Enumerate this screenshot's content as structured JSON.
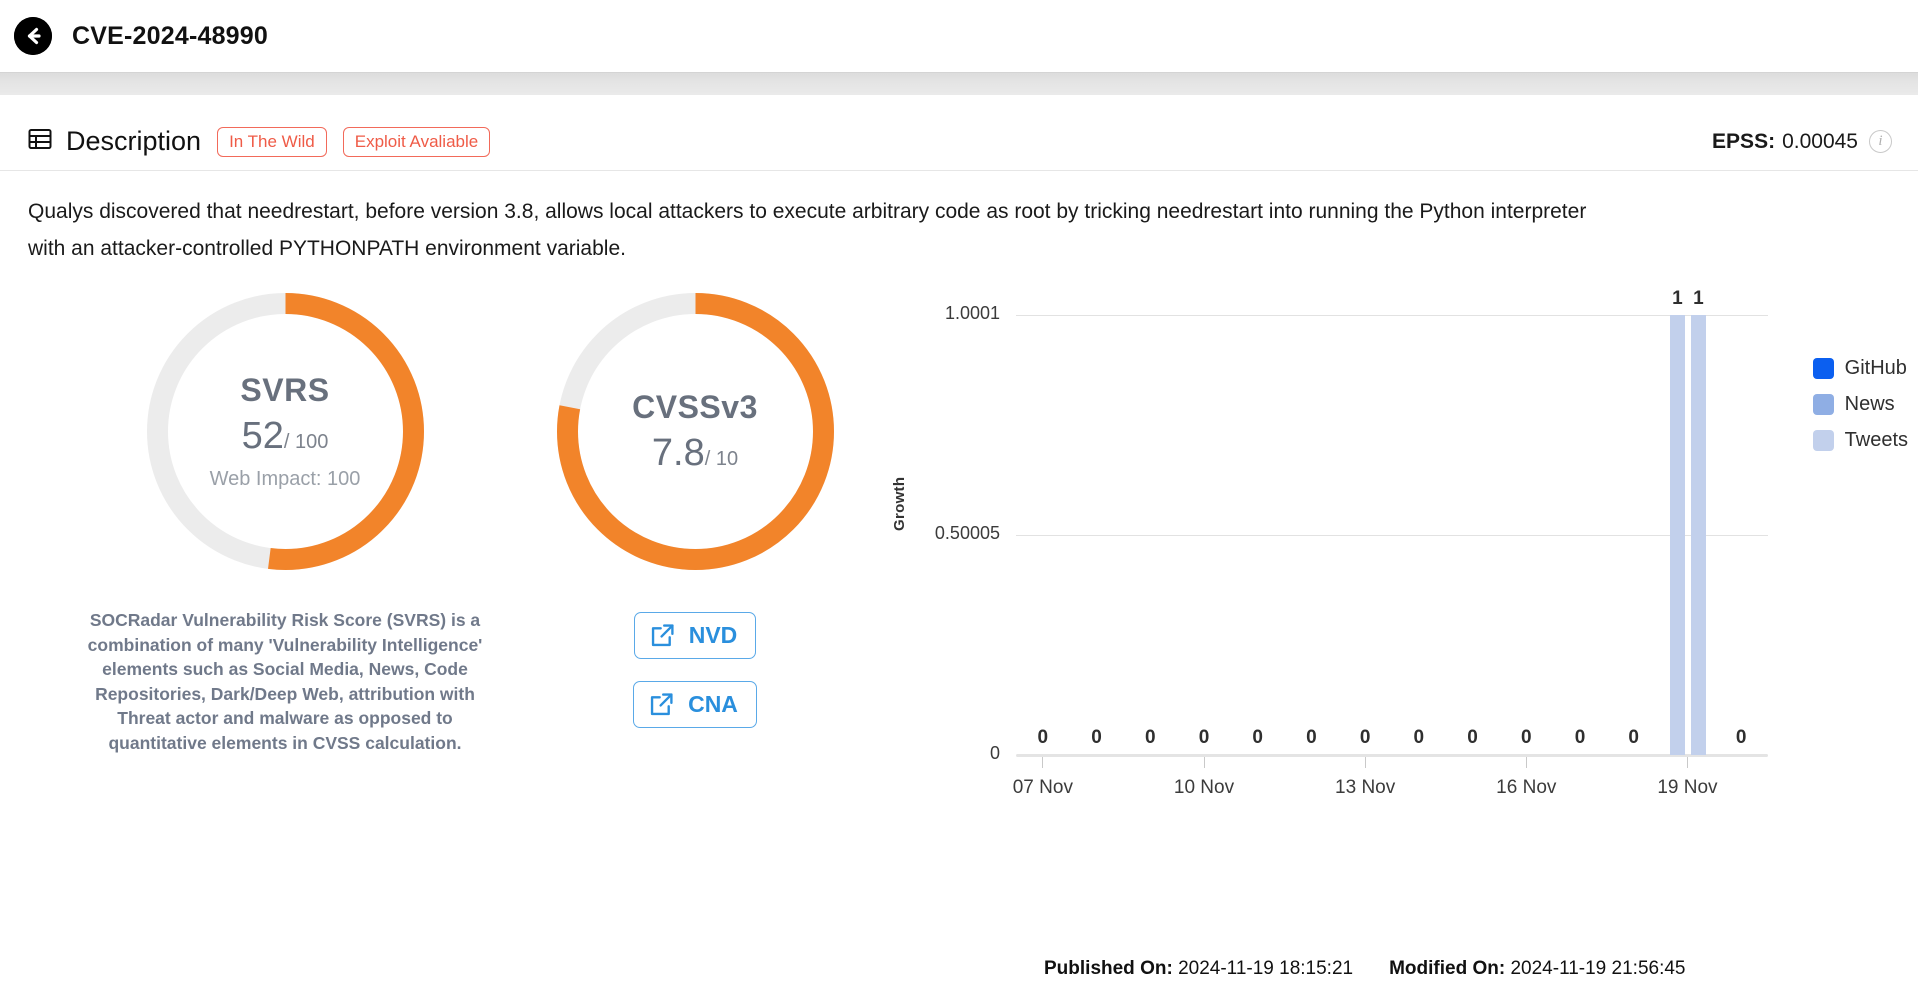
{
  "header": {
    "back_icon": "arrow-left-circle-icon",
    "cve_id": "CVE-2024-48990"
  },
  "description_section": {
    "section_icon": "table-list-icon",
    "title": "Description",
    "tags": [
      "In The Wild",
      "Exploit Avaliable"
    ],
    "epss_label": "EPSS:",
    "epss_value": "0.00045",
    "info_icon": "info-circle-icon",
    "text": "Qualys discovered that needrestart, before version 3.8, allows local attackers to execute arbitrary code as root by tricking needrestart into running the Python interpreter with an attacker-controlled PYTHONPATH environment variable."
  },
  "svrs": {
    "name": "SVRS",
    "value": "52",
    "denominator": "/ 100",
    "percent": 52,
    "sub_label": "Web Impact: 100",
    "note": "SOCRadar Vulnerability Risk Score (SVRS) is a combination of many 'Vulnerability Intelligence' elements such as Social Media, News, Code Repositories, Dark/Deep Web, attribution with Threat actor and malware as opposed to quantitative elements in CVSS calculation."
  },
  "cvss": {
    "name": "CVSSv3",
    "value": "7.8",
    "denominator": "/ 10",
    "percent": 78,
    "buttons": [
      {
        "label": "NVD",
        "icon": "external-link-icon"
      },
      {
        "label": "CNA",
        "icon": "external-link-icon"
      }
    ]
  },
  "colors": {
    "gauge_arc": "#F2842A",
    "gauge_track": "#ECECEC",
    "tag_red": "#EF5B47",
    "link_blue": "#2A8FDD",
    "github": "#0B5FF0",
    "news": "#8FAEE4",
    "tweets": "#C2D0EC"
  },
  "chart_data": {
    "type": "bar",
    "title": "",
    "xlabel": "",
    "ylabel": "Growth",
    "ylim": [
      0,
      1.0001
    ],
    "yticks": [
      "0",
      "0.50005",
      "1.0001"
    ],
    "grid": true,
    "legend_position": "right",
    "legend": [
      "GitHub",
      "News",
      "Tweets"
    ],
    "xtick_labels": [
      "07 Nov",
      "10 Nov",
      "13 Nov",
      "16 Nov",
      "19 Nov"
    ],
    "xtick_indices": [
      0,
      3,
      6,
      9,
      12
    ],
    "categories": [
      "07 Nov",
      "08 Nov",
      "09 Nov",
      "10 Nov",
      "11 Nov",
      "12 Nov",
      "13 Nov",
      "14 Nov",
      "15 Nov",
      "16 Nov",
      "17 Nov",
      "18 Nov",
      "19 Nov",
      "20 Nov"
    ],
    "series": [
      {
        "name": "Tweets",
        "color": "#C2D0EC",
        "values": [
          0,
          0,
          0,
          0,
          0,
          0,
          0,
          0,
          0,
          0,
          0,
          0,
          1,
          0
        ]
      }
    ],
    "point_labels": [
      "0",
      "0",
      "0",
      "0",
      "0",
      "0",
      "0",
      "0",
      "0",
      "0",
      "0",
      "0",
      "1",
      "0"
    ],
    "extra_bar": {
      "label": "1",
      "value": 1,
      "note": "second bar at 19 Nov"
    }
  },
  "footer": {
    "published_label": "Published On:",
    "published_value": "2024-11-19 18:15:21",
    "modified_label": "Modified On:",
    "modified_value": "2024-11-19 21:56:45"
  }
}
